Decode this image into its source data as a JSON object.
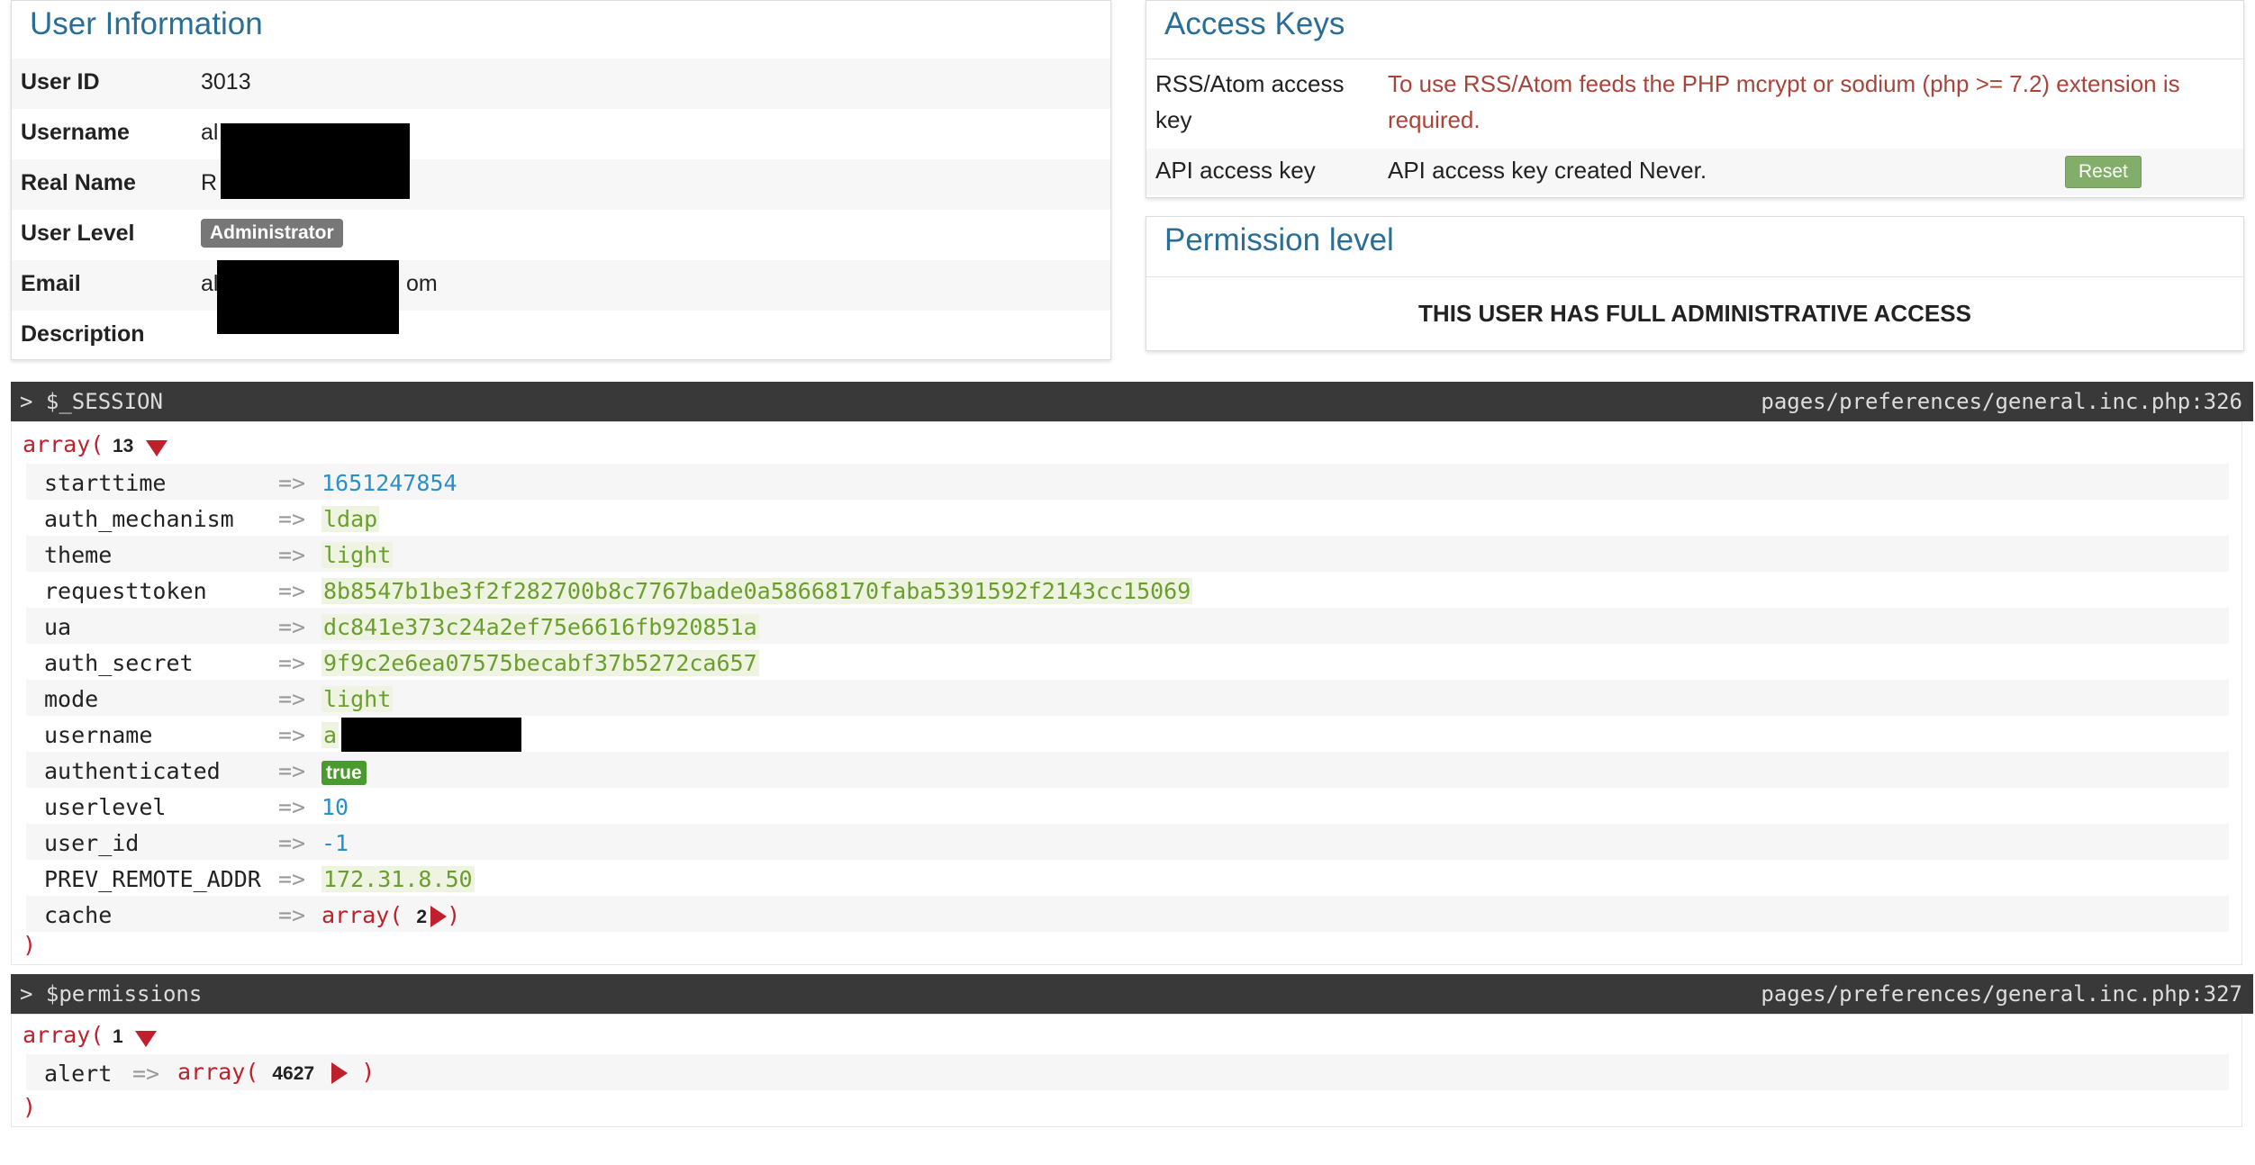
{
  "user_info": {
    "title": "User Information",
    "rows": [
      {
        "label": "User ID",
        "value": "3013"
      },
      {
        "label": "Username",
        "value": "al"
      },
      {
        "label": "Real Name",
        "value": "R"
      },
      {
        "label": "User Level",
        "value": "Administrator"
      },
      {
        "label": "Email",
        "value": "al",
        "suffix": "om"
      },
      {
        "label": "Description",
        "value": ""
      }
    ]
  },
  "access_keys": {
    "title": "Access Keys",
    "rss_label_line1": "RSS/Atom access",
    "rss_label_line2": "key",
    "rss_error_line1": "To use RSS/Atom feeds the PHP mcrypt or sodium (php >= 7.2) extension is",
    "rss_error_line2": "required.",
    "api_label": "API access key",
    "api_value": "API access key created Never.",
    "reset_label": "Reset"
  },
  "permission": {
    "title": "Permission level",
    "text": "THIS USER HAS FULL ADMINISTRATIVE ACCESS"
  },
  "session_dump": {
    "name": "> $_SESSION",
    "location": "pages/preferences/general.inc.php:326",
    "array_kw": "array(",
    "count": "13",
    "close": ")",
    "arrow": "=>",
    "entries": [
      {
        "key": "starttime",
        "value": "1651247854",
        "type": "num"
      },
      {
        "key": "auth_mechanism",
        "value": "ldap",
        "type": "str"
      },
      {
        "key": "theme",
        "value": "light",
        "type": "str"
      },
      {
        "key": "requesttoken",
        "value": "8b8547b1be3f2f282700b8c7767bade0a58668170faba5391592f2143cc15069",
        "type": "str"
      },
      {
        "key": "ua",
        "value": "dc841e373c24a2ef75e6616fb920851a",
        "type": "str"
      },
      {
        "key": "auth_secret",
        "value": "9f9c2e6ea07575becabf37b5272ca657",
        "type": "str"
      },
      {
        "key": "mode",
        "value": "light",
        "type": "str"
      },
      {
        "key": "username",
        "value": "a",
        "type": "str"
      },
      {
        "key": "authenticated",
        "value": "true",
        "type": "bool"
      },
      {
        "key": "userlevel",
        "value": "10",
        "type": "num"
      },
      {
        "key": "user_id",
        "value": "-1",
        "type": "num"
      },
      {
        "key": "PREV_REMOTE_ADDR",
        "value": "172.31.8.50",
        "type": "str"
      },
      {
        "key": "cache",
        "value": "array(",
        "count": "2",
        "close": ")",
        "type": "array"
      }
    ]
  },
  "permissions_dump": {
    "name": "> $permissions",
    "location": "pages/preferences/general.inc.php:327",
    "array_kw": "array(",
    "count": "1",
    "close": ")",
    "entry_key": "alert",
    "entry_arrow": "=>",
    "entry_value": "array(",
    "entry_count": "4627",
    "entry_close": ")"
  },
  "icons": {
    "expanded": "triangle-down-icon",
    "collapsed": "triangle-right-icon"
  },
  "colors": {
    "accent": "#2a6e96",
    "error": "#a9443a",
    "array_keyword": "#c0202c",
    "number": "#2b8fc9",
    "string": "#6a9f2e",
    "header_bg": "#393939"
  }
}
